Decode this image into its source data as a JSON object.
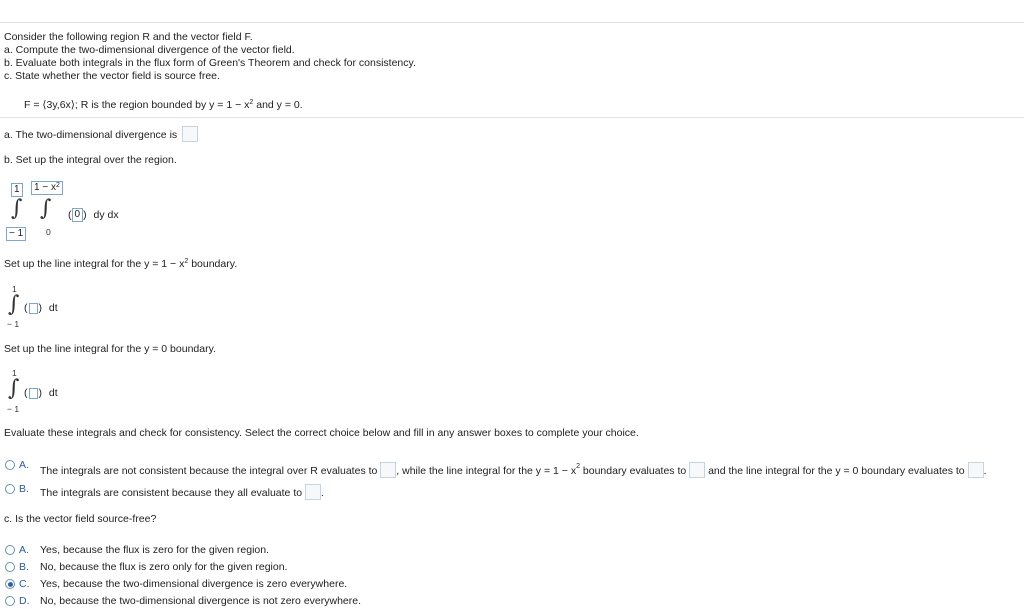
{
  "intro": {
    "line1": "Consider the following region R and the vector field F.",
    "line2": "a. Compute the two-dimensional divergence of the vector field.",
    "line3": "b. Evaluate both integrals in the flux form of Green's Theorem and check for consistency.",
    "line4": "c. State whether the vector field is source free."
  },
  "problem": {
    "field_text": "F = ⟨3y,6x⟩; R is the region bounded by y = 1 − x",
    "exp": "2",
    "tail": " and y = 0."
  },
  "part_a": {
    "label": "a. The two-dimensional divergence is"
  },
  "part_b": {
    "label": "b. Set up the integral over the region.",
    "outer_upper": "1",
    "outer_lower": "− 1",
    "inner_upper_pre": "1 − x",
    "inner_upper_exp": "2",
    "inner_lower": "0",
    "integrand": "0",
    "differentials": "dy dx",
    "line1_prompt_pre": "Set up the line integral for the y = 1 − x",
    "line1_prompt_exp": "2",
    "line1_prompt_post": " boundary.",
    "line1_upper": "1",
    "line1_lower": "− 1",
    "dt": "dt",
    "line2_prompt": "Set up the line integral for the y = 0 boundary.",
    "line2_upper": "1",
    "line2_lower": "− 1",
    "evaluate_prompt": "Evaluate these integrals and check for consistency. Select the correct choice below and fill in any answer boxes to complete your choice."
  },
  "choices_b": [
    {
      "letter": "A.",
      "pre": "The integrals are not consistent because the integral over R evaluates to",
      "mid1": ", while the line integral for the y = 1 − x",
      "exp": "2",
      "mid2": " boundary evaluates to",
      "mid3": "and the line integral for the y = 0 boundary evaluates to",
      "end": "."
    },
    {
      "letter": "B.",
      "pre": "The integrals are consistent because they all evaluate to",
      "end": "."
    }
  ],
  "part_c": {
    "label": "c. Is the vector field source-free?"
  },
  "choices_c": [
    {
      "letter": "A.",
      "text": "Yes, because the flux is zero for the given region.",
      "selected": false
    },
    {
      "letter": "B.",
      "text": "No, because the flux is zero only for the given region.",
      "selected": false
    },
    {
      "letter": "C.",
      "text": "Yes, because the two-dimensional divergence is zero everywhere.",
      "selected": true
    },
    {
      "letter": "D.",
      "text": "No, because the two-dimensional divergence is not zero everywhere.",
      "selected": false
    }
  ]
}
